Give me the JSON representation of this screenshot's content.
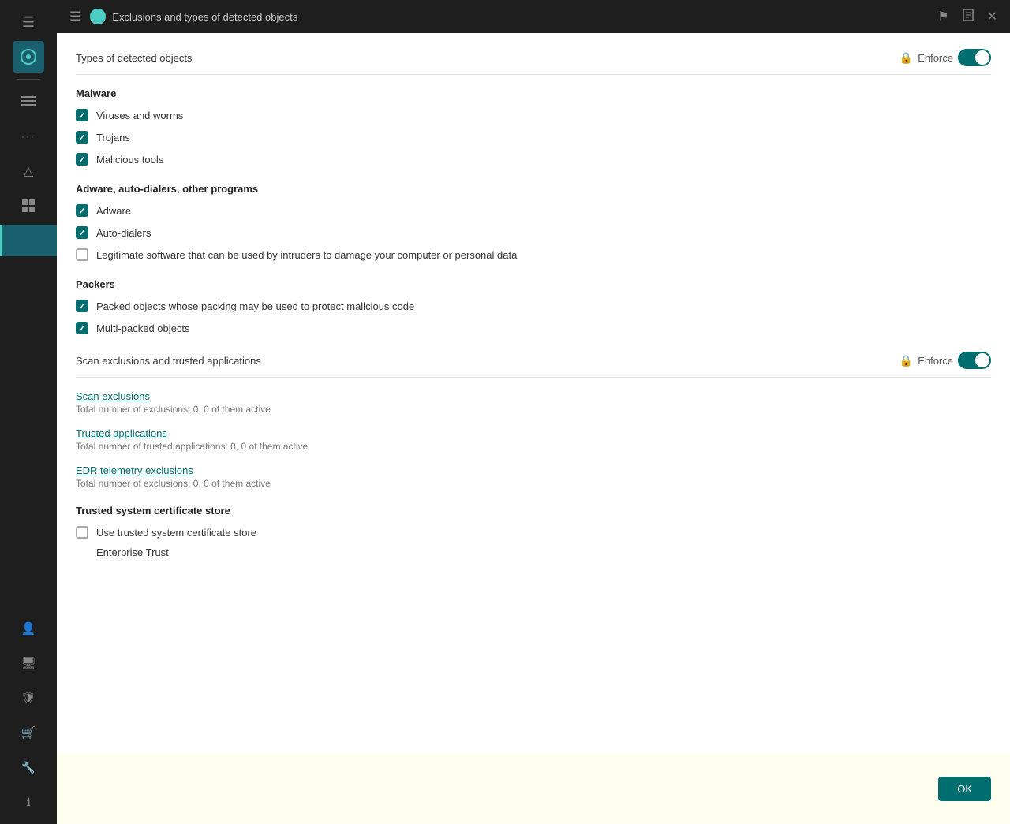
{
  "titleBar": {
    "title": "Exclusions and types of detected objects",
    "menuIcon": "☰",
    "appIcon": "K",
    "flagIcon": "⚑",
    "bookIcon": "📖",
    "closeIcon": "✕"
  },
  "sidebar": {
    "icons": [
      {
        "name": "menu-icon",
        "symbol": "☰",
        "active": false
      },
      {
        "name": "dashboard-icon",
        "symbol": "⊙",
        "active": true
      },
      {
        "name": "divider1",
        "type": "divider"
      },
      {
        "name": "list-icon",
        "symbol": "≡",
        "active": false
      },
      {
        "name": "dots-icon",
        "symbol": "⋯",
        "active": false
      },
      {
        "name": "warning-icon",
        "symbol": "△",
        "active": false
      },
      {
        "name": "table-icon",
        "symbol": "⊞",
        "active": false
      },
      {
        "name": "active-item",
        "symbol": "",
        "active": true
      }
    ],
    "bottomIcons": [
      {
        "name": "user-icon",
        "symbol": "👤"
      },
      {
        "name": "device-icon",
        "symbol": "🖥"
      },
      {
        "name": "shield-icon",
        "symbol": "🛡"
      },
      {
        "name": "cart-icon",
        "symbol": "🛒"
      },
      {
        "name": "wrench-icon",
        "symbol": "🔧"
      },
      {
        "name": "info-icon",
        "symbol": "ℹ"
      }
    ]
  },
  "sections": {
    "typesOfDetectedObjects": {
      "title": "Types of detected objects",
      "enforceLabel": "Enforce",
      "enforceEnabled": true
    },
    "malware": {
      "label": "Malware",
      "items": [
        {
          "id": "viruses",
          "label": "Viruses and worms",
          "checked": true
        },
        {
          "id": "trojans",
          "label": "Trojans",
          "checked": true
        },
        {
          "id": "malicious-tools",
          "label": "Malicious tools",
          "checked": true
        }
      ]
    },
    "adware": {
      "label": "Adware, auto-dialers, other programs",
      "items": [
        {
          "id": "adware",
          "label": "Adware",
          "checked": true
        },
        {
          "id": "auto-dialers",
          "label": "Auto-dialers",
          "checked": true
        },
        {
          "id": "legitimate-software",
          "label": "Legitimate software that can be used by intruders to damage your computer or personal data",
          "checked": false
        }
      ]
    },
    "packers": {
      "label": "Packers",
      "items": [
        {
          "id": "packed-objects",
          "label": "Packed objects whose packing may be used to protect malicious code",
          "checked": true
        },
        {
          "id": "multi-packed",
          "label": "Multi-packed objects",
          "checked": true
        }
      ]
    },
    "scanExclusions": {
      "title": "Scan exclusions and trusted applications",
      "enforceLabel": "Enforce",
      "enforceEnabled": true
    },
    "links": [
      {
        "id": "scan-exclusions",
        "linkText": "Scan exclusions",
        "description": "Total number of exclusions: 0, 0 of them active"
      },
      {
        "id": "trusted-applications",
        "linkText": "Trusted applications",
        "description": "Total number of trusted applications: 0, 0 of them active"
      },
      {
        "id": "edr-telemetry",
        "linkText": "EDR telemetry exclusions",
        "description": "Total number of exclusions: 0, 0 of them active"
      }
    ],
    "trustedCertStore": {
      "label": "Trusted system certificate store",
      "items": [
        {
          "id": "use-trusted-cert",
          "label": "Use trusted system certificate store",
          "checked": false
        }
      ],
      "enterpriseTrust": "Enterprise Trust"
    }
  },
  "footer": {
    "okLabel": "OK"
  }
}
